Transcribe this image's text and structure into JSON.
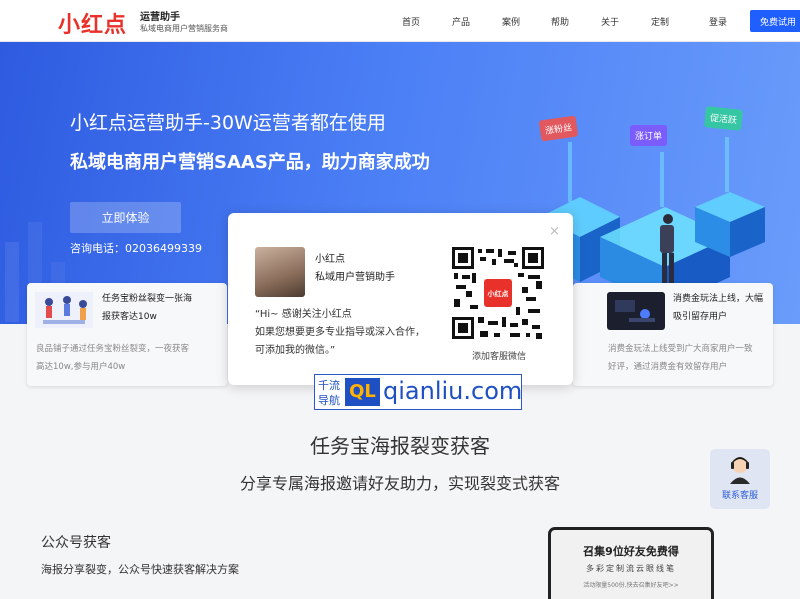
{
  "header": {
    "logo": "小红点",
    "brand_title": "运营助手",
    "brand_subtitle": "私域电商用户营销服务商",
    "nav": [
      "首页",
      "产品",
      "案例",
      "帮助",
      "关于",
      "定制"
    ],
    "login": "登录",
    "trial": "免费试用",
    "accent": "#1f5eff",
    "logo_color": "#e8312a"
  },
  "hero": {
    "headline": "小红点运营助手-30W运营者都在使用",
    "subheadline": "私域电商用户营销SAAS产品，助力商家成功",
    "cta": "立即体验",
    "phone": "咨询电话：02036499339",
    "tags": [
      "涨粉丝",
      "涨订单",
      "促活跃"
    ]
  },
  "cards": [
    {
      "title_line1": "任务宝粉丝裂变一张海",
      "title_line2": "报获客达10w",
      "desc_line1": "良品铺子通过任务宝粉丝裂变，一夜获客",
      "desc_line2": "高达10w,参与用户40w"
    },
    {
      "title_line1": "消费金玩法上线，大幅",
      "title_line2": "吸引留存用户",
      "desc_line1": "消费金玩法上线受到广大商家用户一致",
      "desc_line2": "好评，通过消费金有效留存用户"
    }
  ],
  "modal": {
    "close": "×",
    "name": "小红点",
    "role": "私域用户营销助手",
    "msg_line1": "“Hi~ 感谢关注小红点",
    "msg_line2": "如果您想要更多专业指导或深入合作，",
    "msg_line3": "可添加我的微信。”",
    "qr_center": "小红点",
    "qr_caption": "添加客服微信"
  },
  "watermark": {
    "cn_line1": "千流",
    "cn_line2": "导航",
    "mark": "QL",
    "domain": "qianliu.com"
  },
  "section": {
    "title": "任务宝海报裂变获客",
    "subtitle": "分享专属海报邀请好友助力，实现裂变式获客",
    "feature_title": "公众号获客",
    "feature_desc": "海报分享裂变，公众号快速获客解决方案"
  },
  "support": {
    "label": "联系客服"
  },
  "phone_mock": {
    "title": "召集9位好友免费得",
    "subtitle": "多彩定制流云眼线笔",
    "small": "活动限量500份,快去召集好友吧>>"
  }
}
